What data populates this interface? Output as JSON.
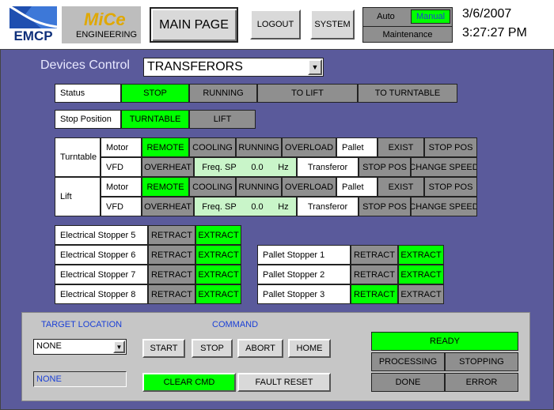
{
  "header": {
    "logo_emcp": "EMCP",
    "logo_mice": "MiCe",
    "logo_engineering": "ENGINEERING",
    "main_page": "MAIN PAGE",
    "logout": "LOGOUT",
    "system": "SYSTEM",
    "mode_auto": "Auto",
    "mode_manual": "Manual",
    "mode_maintenance": "Maintenance",
    "date": "3/6/2007",
    "time": "3:27:27 PM"
  },
  "devices": {
    "title": "Devices Control",
    "selected": "TRANSFERORS"
  },
  "status": {
    "label": "Status",
    "items": [
      "STOP",
      "RUNNING",
      "TO LIFT",
      "TO TURNTABLE"
    ]
  },
  "stop_position": {
    "label": "Stop Position",
    "items": [
      "TURNTABLE",
      "LIFT"
    ]
  },
  "turntable": {
    "label": "Turntable",
    "motor_label": "Motor",
    "motor_items": [
      "REMOTE",
      "COOLING",
      "RUNNING",
      "OVERLOAD"
    ],
    "pallet_label": "Pallet",
    "pallet_items": [
      "EXIST",
      "STOP POS"
    ],
    "vfd_label": "VFD",
    "overheat": "OVERHEAT",
    "freq_label": "Freq. SP",
    "freq_value": "0.0",
    "freq_unit": "Hz",
    "transferor_label": "Transferor",
    "transferor_items": [
      "STOP POS",
      "CHANGE SPEED"
    ]
  },
  "lift": {
    "label": "Lift",
    "motor_label": "Motor",
    "motor_items": [
      "REMOTE",
      "COOLING",
      "RUNNING",
      "OVERLOAD"
    ],
    "pallet_label": "Pallet",
    "pallet_items": [
      "EXIST",
      "STOP POS"
    ],
    "vfd_label": "VFD",
    "overheat": "OVERHEAT",
    "freq_label": "Freq. SP",
    "freq_value": "0.0",
    "freq_unit": "Hz",
    "transferor_label": "Transferor",
    "transferor_items": [
      "STOP POS",
      "CHANGE SPEED"
    ]
  },
  "electrical_stoppers": [
    {
      "label": "Electrical Stopper 5",
      "retract": "RETRACT",
      "extract": "EXTRACT",
      "active": "extract"
    },
    {
      "label": "Electrical Stopper 6",
      "retract": "RETRACT",
      "extract": "EXTRACT",
      "active": "extract"
    },
    {
      "label": "Electrical Stopper 7",
      "retract": "RETRACT",
      "extract": "EXTRACT",
      "active": "extract"
    },
    {
      "label": "Electrical Stopper 8",
      "retract": "RETRACT",
      "extract": "EXTRACT",
      "active": "extract"
    }
  ],
  "pallet_stoppers": [
    {
      "label": "Pallet Stopper 1",
      "retract": "RETRACT",
      "extract": "EXTRACT",
      "active": "extract"
    },
    {
      "label": "Pallet Stopper 2",
      "retract": "RETRACT",
      "extract": "EXTRACT",
      "active": "extract"
    },
    {
      "label": "Pallet Stopper 3",
      "retract": "RETRACT",
      "extract": "EXTRACT",
      "active": "retract"
    }
  ],
  "bottom": {
    "target_location_label": "TARGET LOCATION",
    "target_location_value": "NONE",
    "target_display": "NONE",
    "command_label": "COMMAND",
    "commands": [
      "START",
      "STOP",
      "ABORT",
      "HOME"
    ],
    "clear_cmd": "CLEAR CMD",
    "fault_reset": "FAULT RESET",
    "ready": "READY",
    "processing": "PROCESSING",
    "stopping": "STOPPING",
    "done": "DONE",
    "error": "ERROR"
  },
  "colors": {
    "active": "#00ff00",
    "inactive": "#8f8f8f",
    "panel": "#5a5a9b",
    "accent_blue": "#1a3fd6"
  }
}
